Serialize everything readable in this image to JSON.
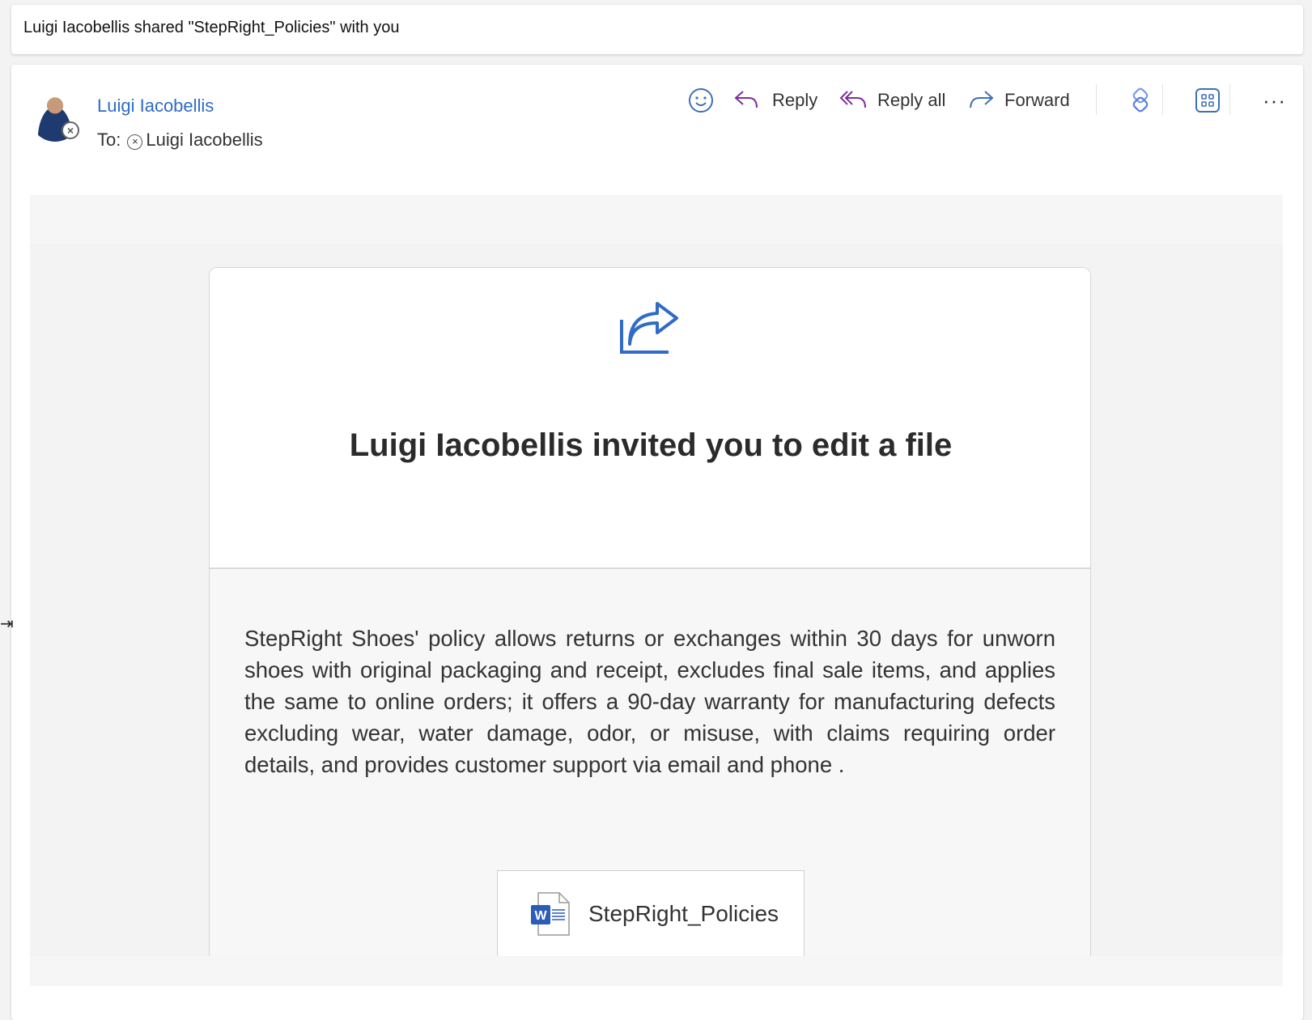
{
  "subject": "Luigi Iacobellis shared \"StepRight_Policies\" with you",
  "sender": {
    "name": "Luigi Iacobellis",
    "to_label": "To:",
    "recipient": "Luigi Iacobellis"
  },
  "toolbar": {
    "reply": "Reply",
    "reply_all": "Reply all",
    "forward": "Forward"
  },
  "body": {
    "heading": "Luigi Iacobellis invited you to edit a file",
    "message": "StepRight Shoes' policy allows returns or exchanges within 30 days for unworn shoes with original packaging and receipt, excludes final sale items, and applies the same to online orders; it offers a 90-day warranty for manufacturing defects excluding wear, water damage, odor, or misuse, with claims requiring order details, and provides customer support via email and phone .",
    "file_name": "StepRight_Policies",
    "file_icon_letter": "W"
  },
  "colors": {
    "accent": "#2f6bc7",
    "reply_purple": "#7a2f9e",
    "word_blue": "#2b5cb8"
  }
}
